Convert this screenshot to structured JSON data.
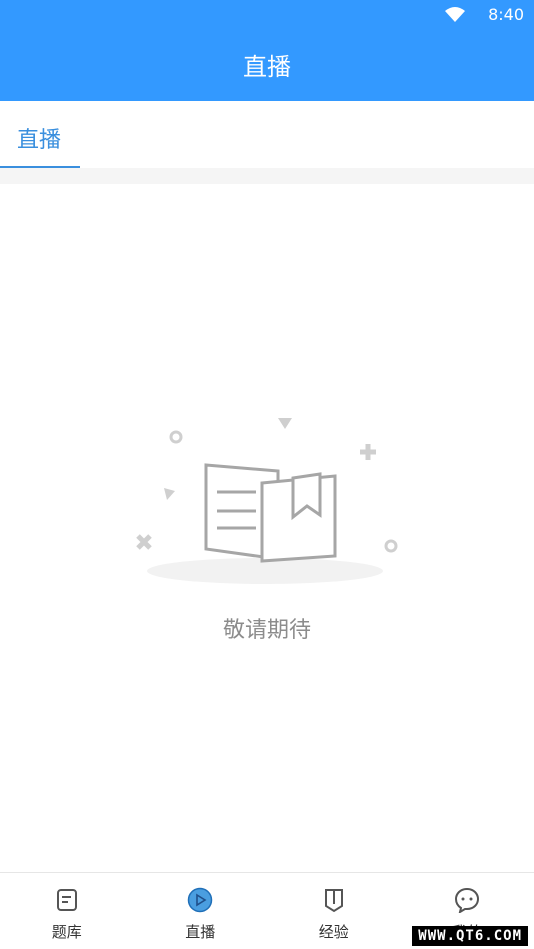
{
  "status_bar": {
    "time": "8:40"
  },
  "header": {
    "title": "直播"
  },
  "tabs": [
    {
      "label": "直播",
      "active": true
    }
  ],
  "empty_state": {
    "message": "敬请期待"
  },
  "bottom_nav": {
    "items": [
      {
        "label": "题库",
        "icon": "question-bank-icon",
        "active": false
      },
      {
        "label": "直播",
        "icon": "live-play-icon",
        "active": true
      },
      {
        "label": "经验",
        "icon": "experience-bookmark-icon",
        "active": false
      },
      {
        "label": "我的",
        "icon": "profile-chat-icon",
        "active": false
      }
    ]
  },
  "watermark": "WWW.QT6.COM",
  "colors": {
    "primary": "#3399ff",
    "tab_accent": "#3a8fde",
    "muted_text": "#8c8c8c"
  }
}
